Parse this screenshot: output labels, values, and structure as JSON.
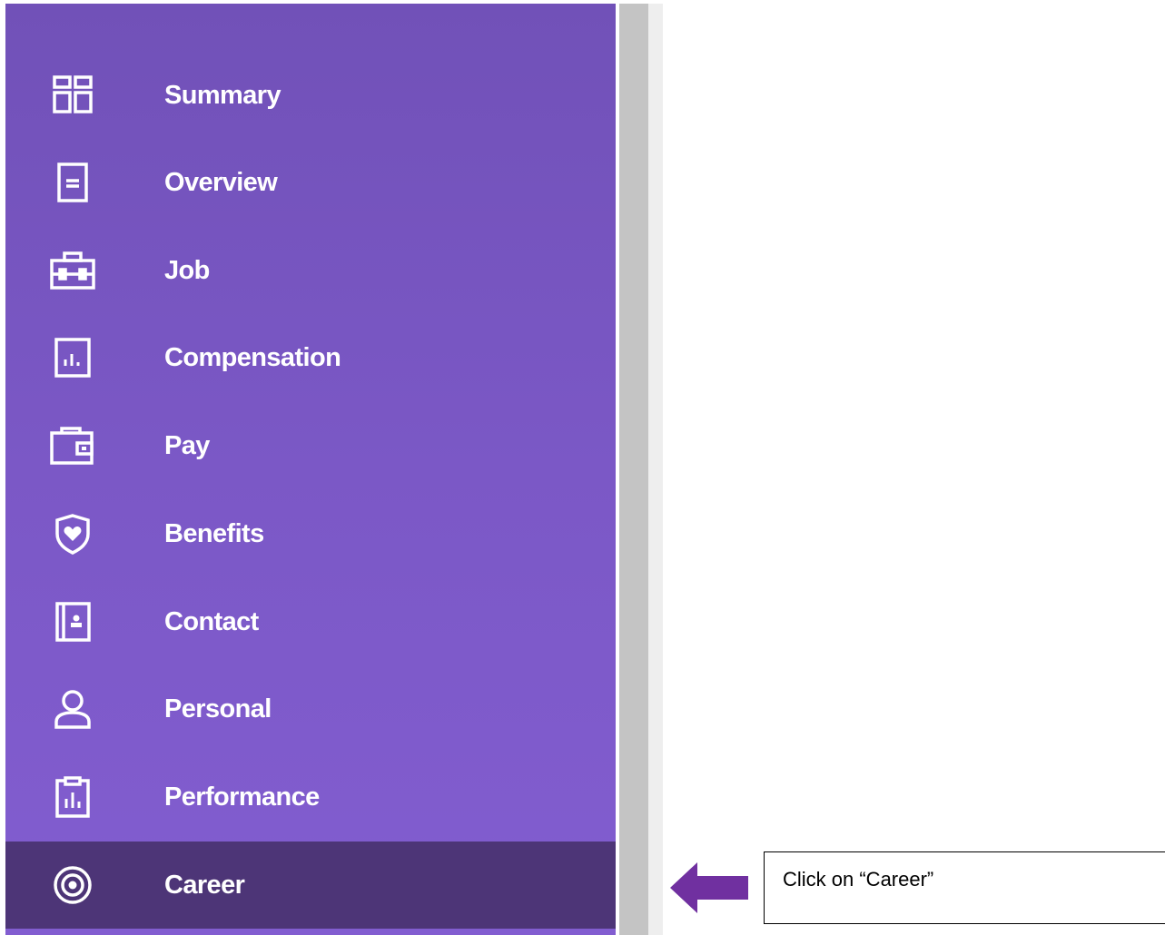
{
  "sidebar": {
    "items": [
      {
        "label": "Summary",
        "icon": "dashboard-grid-icon"
      },
      {
        "label": "Overview",
        "icon": "document-icon"
      },
      {
        "label": "Job",
        "icon": "briefcase-icon"
      },
      {
        "label": "Compensation",
        "icon": "bar-chart-icon"
      },
      {
        "label": "Pay",
        "icon": "wallet-icon"
      },
      {
        "label": "Benefits",
        "icon": "shield-heart-icon"
      },
      {
        "label": "Contact",
        "icon": "address-book-icon"
      },
      {
        "label": "Personal",
        "icon": "person-icon"
      },
      {
        "label": "Performance",
        "icon": "clipboard-chart-icon"
      },
      {
        "label": "Career",
        "icon": "target-icon",
        "active": true
      }
    ],
    "background": "#7b58c6",
    "active_background": "#4d3577"
  },
  "callout": {
    "text": "Click on “Career”",
    "arrow_color": "#7030a0"
  }
}
